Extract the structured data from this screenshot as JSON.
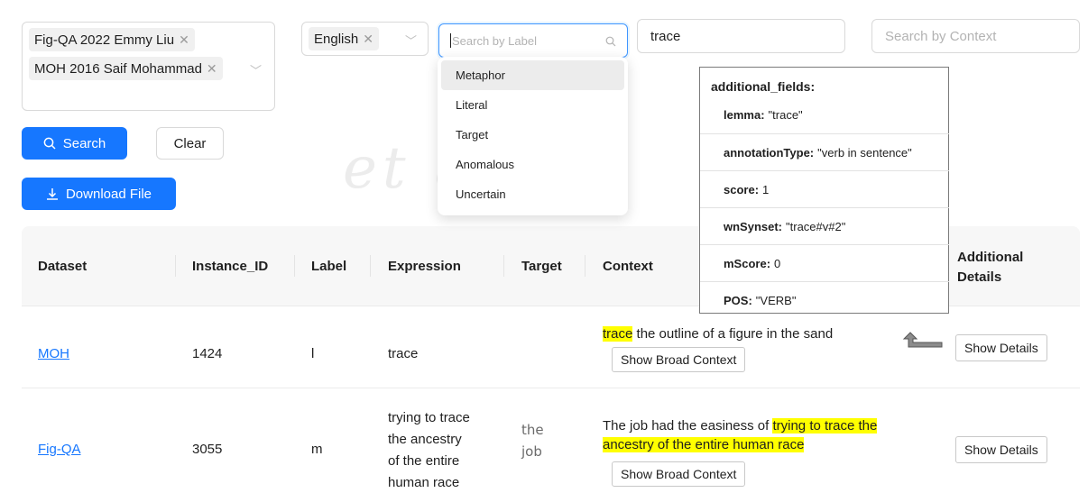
{
  "watermark": "et   ao",
  "filters": {
    "datasets": [
      "Fig-QA 2022 Emmy Liu",
      "MOH 2016 Saif Mohammad"
    ],
    "languages": [
      "English"
    ],
    "label_search_placeholder": "Search by Label",
    "expression_search_value": "trace",
    "context_search_placeholder": "Search by Context"
  },
  "label_options": [
    "Metaphor",
    "Literal",
    "Target",
    "Anomalous",
    "Uncertain"
  ],
  "buttons": {
    "search": "Search",
    "clear": "Clear",
    "download": "Download File"
  },
  "table": {
    "headers": {
      "dataset": "Dataset",
      "instance_id": "Instance_ID",
      "label": "Label",
      "expression": "Expression",
      "target": "Target",
      "context": "Context",
      "additional_l1": "Additional",
      "additional_l2": "Details"
    },
    "rows": [
      {
        "dataset": "MOH",
        "instance_id": "1424",
        "label": "l",
        "expression": "trace",
        "target": "",
        "context_pre": "",
        "context_hl": "trace",
        "context_post": " the outline of a figure in the sand",
        "broad_button": "Show Broad Context",
        "details_button": "Show Details"
      },
      {
        "dataset": "Fig-QA",
        "instance_id": "3055",
        "label": "m",
        "expression_lines": [
          "trying to trace",
          "the ancestry",
          "of the entire",
          "human race"
        ],
        "target_lines": [
          "the",
          "job"
        ],
        "context_pre": "The job had the easiness of ",
        "context_hl_1": "trying to trace the",
        "context_hl_2": "ancestry of the entire human race",
        "broad_button": "Show Broad Context",
        "details_button": "Show Details"
      }
    ]
  },
  "popup": {
    "title": "additional_fields:",
    "fields": [
      {
        "key": "lemma:",
        "value": "\"trace\""
      },
      {
        "key": "annotationType:",
        "value": "\"verb in sentence\""
      },
      {
        "key": "score:",
        "value": "1"
      },
      {
        "key": "wnSynset:",
        "value": "\"trace#v#2\""
      },
      {
        "key": "mScore:",
        "value": "0"
      },
      {
        "key": "POS:",
        "value": "\"VERB\""
      }
    ]
  },
  "icons": [
    "close-icon",
    "chevron-down-icon",
    "search-icon",
    "download-icon",
    "return-arrow-icon"
  ],
  "colors": {
    "primary": "#1677ff",
    "highlight": "#ffff00"
  }
}
